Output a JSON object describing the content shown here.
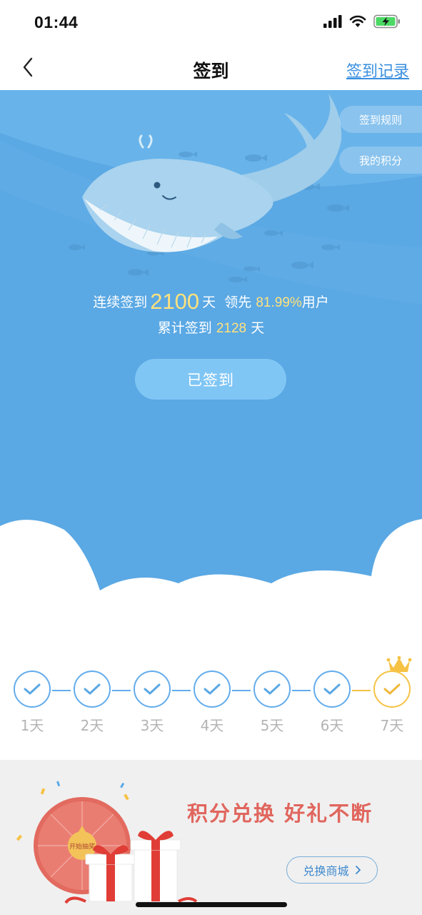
{
  "status": {
    "time": "01:44"
  },
  "nav": {
    "title": "签到",
    "record_link": "签到记录"
  },
  "side": {
    "rules": "签到规则",
    "points": "我的积分"
  },
  "stats": {
    "streak_prefix": "连续签到",
    "streak_days": "2100",
    "streak_unit": "天",
    "lead_prefix": "领先",
    "lead_percent": "81.99%",
    "lead_suffix": "用户",
    "total_prefix": "累计签到",
    "total_days": "2128",
    "total_unit": "天"
  },
  "signed_button": "已签到",
  "days": [
    {
      "label": "1天",
      "checked": true
    },
    {
      "label": "2天",
      "checked": true
    },
    {
      "label": "3天",
      "checked": true
    },
    {
      "label": "4天",
      "checked": true
    },
    {
      "label": "5天",
      "checked": true
    },
    {
      "label": "6天",
      "checked": true
    },
    {
      "label": "7天",
      "checked": true,
      "crown": true
    }
  ],
  "banner": {
    "title": "积分兑换 好礼不断",
    "shop_button": "兑换商城",
    "wheel_center": "开始抽奖"
  },
  "colors": {
    "hero_bg": "#5aa8e4",
    "accent_yellow": "#ffe27d",
    "check_blue": "#63acec",
    "check_gold": "#f6c244",
    "banner_red": "#e0665e"
  },
  "icons": [
    "back-chevron-icon",
    "signal-icon",
    "wifi-icon",
    "battery-charging-icon",
    "check-icon",
    "crown-icon",
    "chevron-right-icon"
  ]
}
